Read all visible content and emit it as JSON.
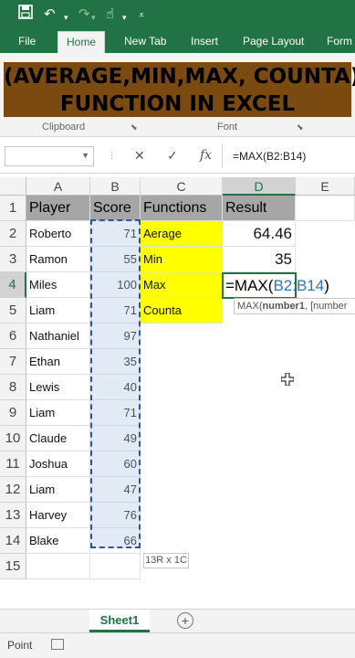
{
  "quick_access": {
    "save_icon": "save-icon",
    "undo_icon": "undo-icon",
    "redo_icon": "redo-icon",
    "touch_icon": "touch-mode-icon",
    "customize_icon": "customize-icon"
  },
  "ribbon_tabs": [
    "File",
    "Home",
    "New Tab",
    "Insert",
    "Page Layout",
    "Form"
  ],
  "active_tab": "Home",
  "banner": {
    "line1": "(AVERAGE,MIN,MAX, COUNTA)",
    "line2": "FUNCTION IN EXCEL"
  },
  "ribbon_groups": [
    "Clipboard",
    "Font"
  ],
  "formula_bar": {
    "name_box": "",
    "cancel": "✕",
    "enter": "✓",
    "fx": "fx",
    "formula": "=MAX(B2:B14)"
  },
  "columns": [
    "A",
    "B",
    "C",
    "D",
    "E"
  ],
  "rows": [
    "1",
    "2",
    "3",
    "4",
    "5",
    "6",
    "7",
    "8",
    "9",
    "10",
    "11",
    "12",
    "13",
    "14",
    "15"
  ],
  "headers": {
    "player": "Player",
    "score": "Score",
    "functions": "Functions",
    "result": "Result"
  },
  "players": [
    {
      "name": "Roberto",
      "score": "71"
    },
    {
      "name": "Ramon",
      "score": "55"
    },
    {
      "name": "Miles",
      "score": "100"
    },
    {
      "name": "Liam",
      "score": "71"
    },
    {
      "name": "Nathaniel",
      "score": "97"
    },
    {
      "name": "Ethan",
      "score": "35"
    },
    {
      "name": "Lewis",
      "score": "40"
    },
    {
      "name": "Liam",
      "score": "71"
    },
    {
      "name": "Claude",
      "score": "49"
    },
    {
      "name": "Joshua",
      "score": "60"
    },
    {
      "name": "Liam",
      "score": "47"
    },
    {
      "name": "Harvey",
      "score": "76"
    },
    {
      "name": "Blake",
      "score": "66"
    }
  ],
  "functions": [
    {
      "label": "Aerage",
      "result": "64.46"
    },
    {
      "label": "Min",
      "result": "35"
    },
    {
      "label": "Max",
      "result": ""
    },
    {
      "label": "Counta",
      "result": ""
    }
  ],
  "edit_cell": {
    "prefix": "=MAX(",
    "ref": "B2:B14",
    "suffix": ")"
  },
  "tooltip": {
    "fn": "MAX(",
    "arg1": "number1",
    "rest": ", [number"
  },
  "selection_size": "13R x 1C",
  "sheet_tab": "Sheet1",
  "status": "Point"
}
